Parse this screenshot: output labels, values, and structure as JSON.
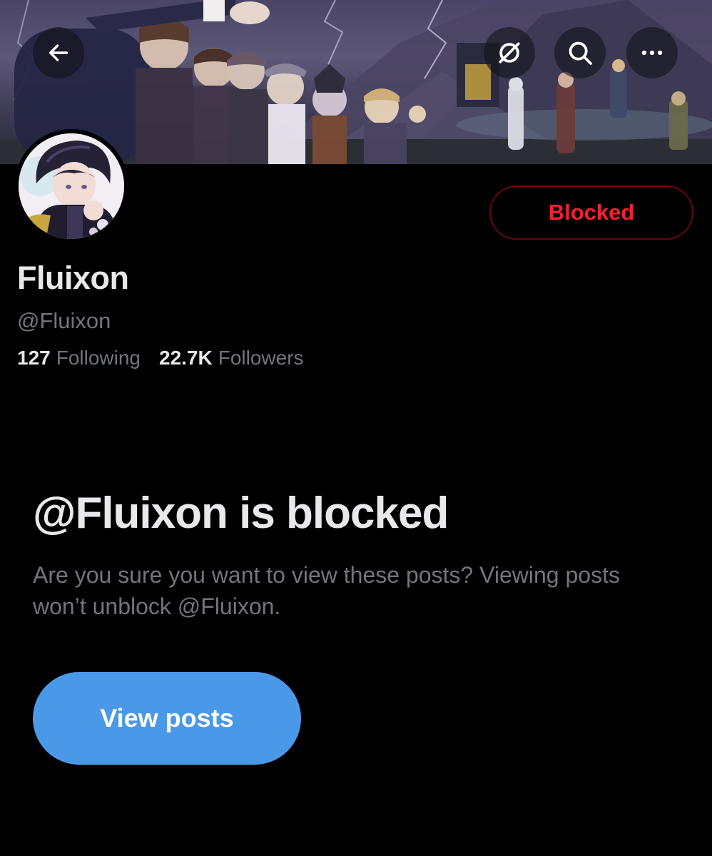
{
  "header": {
    "back_icon": "arrow-left-icon",
    "grok_icon": "grok-icon",
    "search_icon": "search-icon",
    "more_icon": "more-horizontal-icon"
  },
  "profile": {
    "display_name": "Fluixon",
    "handle": "@Fluixon",
    "following_count": "127",
    "following_label": "Following",
    "followers_count": "22.7K",
    "followers_label": "Followers",
    "relationship_button": "Blocked"
  },
  "blocked_notice": {
    "title": "@Fluixon is blocked",
    "description": "Are you sure you want to view these posts? Viewing posts won’t unblock @Fluixon.",
    "view_button": "View posts"
  },
  "colors": {
    "background": "#000000",
    "blocked_red": "#f4212e",
    "accent_blue": "#4a99e9",
    "secondary_text": "#71767b"
  }
}
